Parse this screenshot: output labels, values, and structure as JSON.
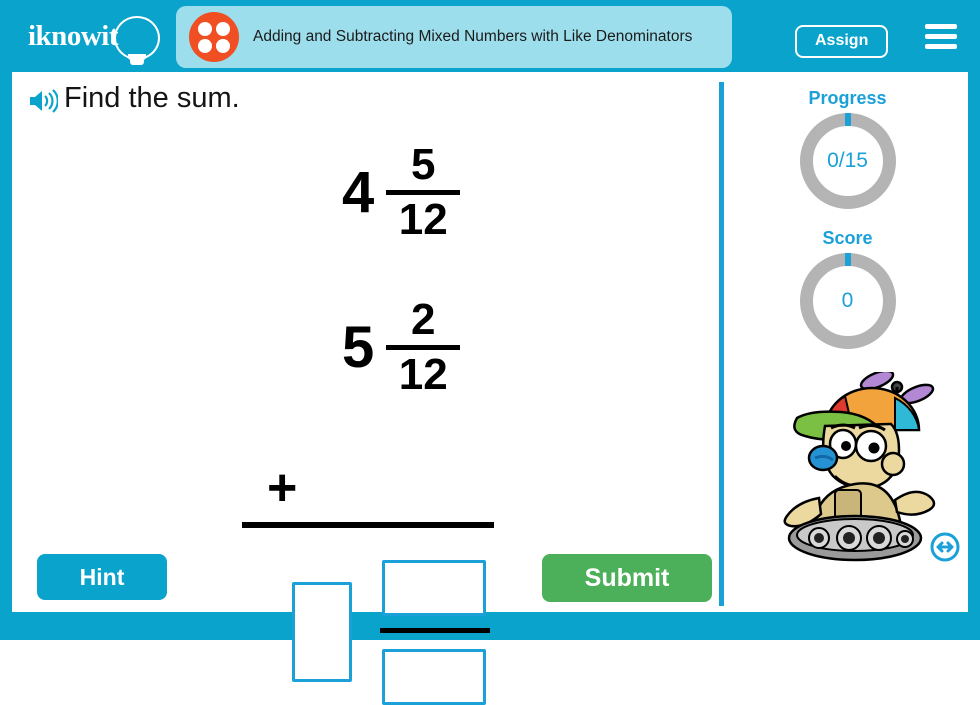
{
  "brand": {
    "logo_text": "iknowit",
    "header_color": "#0aa3cc",
    "accent_color": "#1ba0d8"
  },
  "header": {
    "title": "Adding and Subtracting Mixed Numbers with Like Denominators",
    "assign_label": "Assign",
    "title_pill_color": "#9ddeec",
    "dots_color": "#f04e23"
  },
  "question": {
    "prompt": "Find the sum.",
    "audio_icon": "speaker-icon"
  },
  "problem": {
    "addend1": {
      "whole": "4",
      "numerator": "5",
      "denominator": "12"
    },
    "addend2": {
      "whole": "5",
      "numerator": "2",
      "denominator": "12"
    },
    "operator": "+"
  },
  "answer": {
    "whole_value": "",
    "numerator_value": "",
    "denominator_value": "",
    "box_border_color": "#1ba0d8"
  },
  "actions": {
    "hint_label": "Hint",
    "hint_color": "#0aa3cc",
    "submit_label": "Submit",
    "submit_color": "#4cb05a"
  },
  "sidebar": {
    "progress": {
      "label": "Progress",
      "value": "0/15"
    },
    "score": {
      "label": "Score",
      "value": "0"
    },
    "mascot": "robot-mascot",
    "resize_icon": "resize-horizontal-icon"
  }
}
